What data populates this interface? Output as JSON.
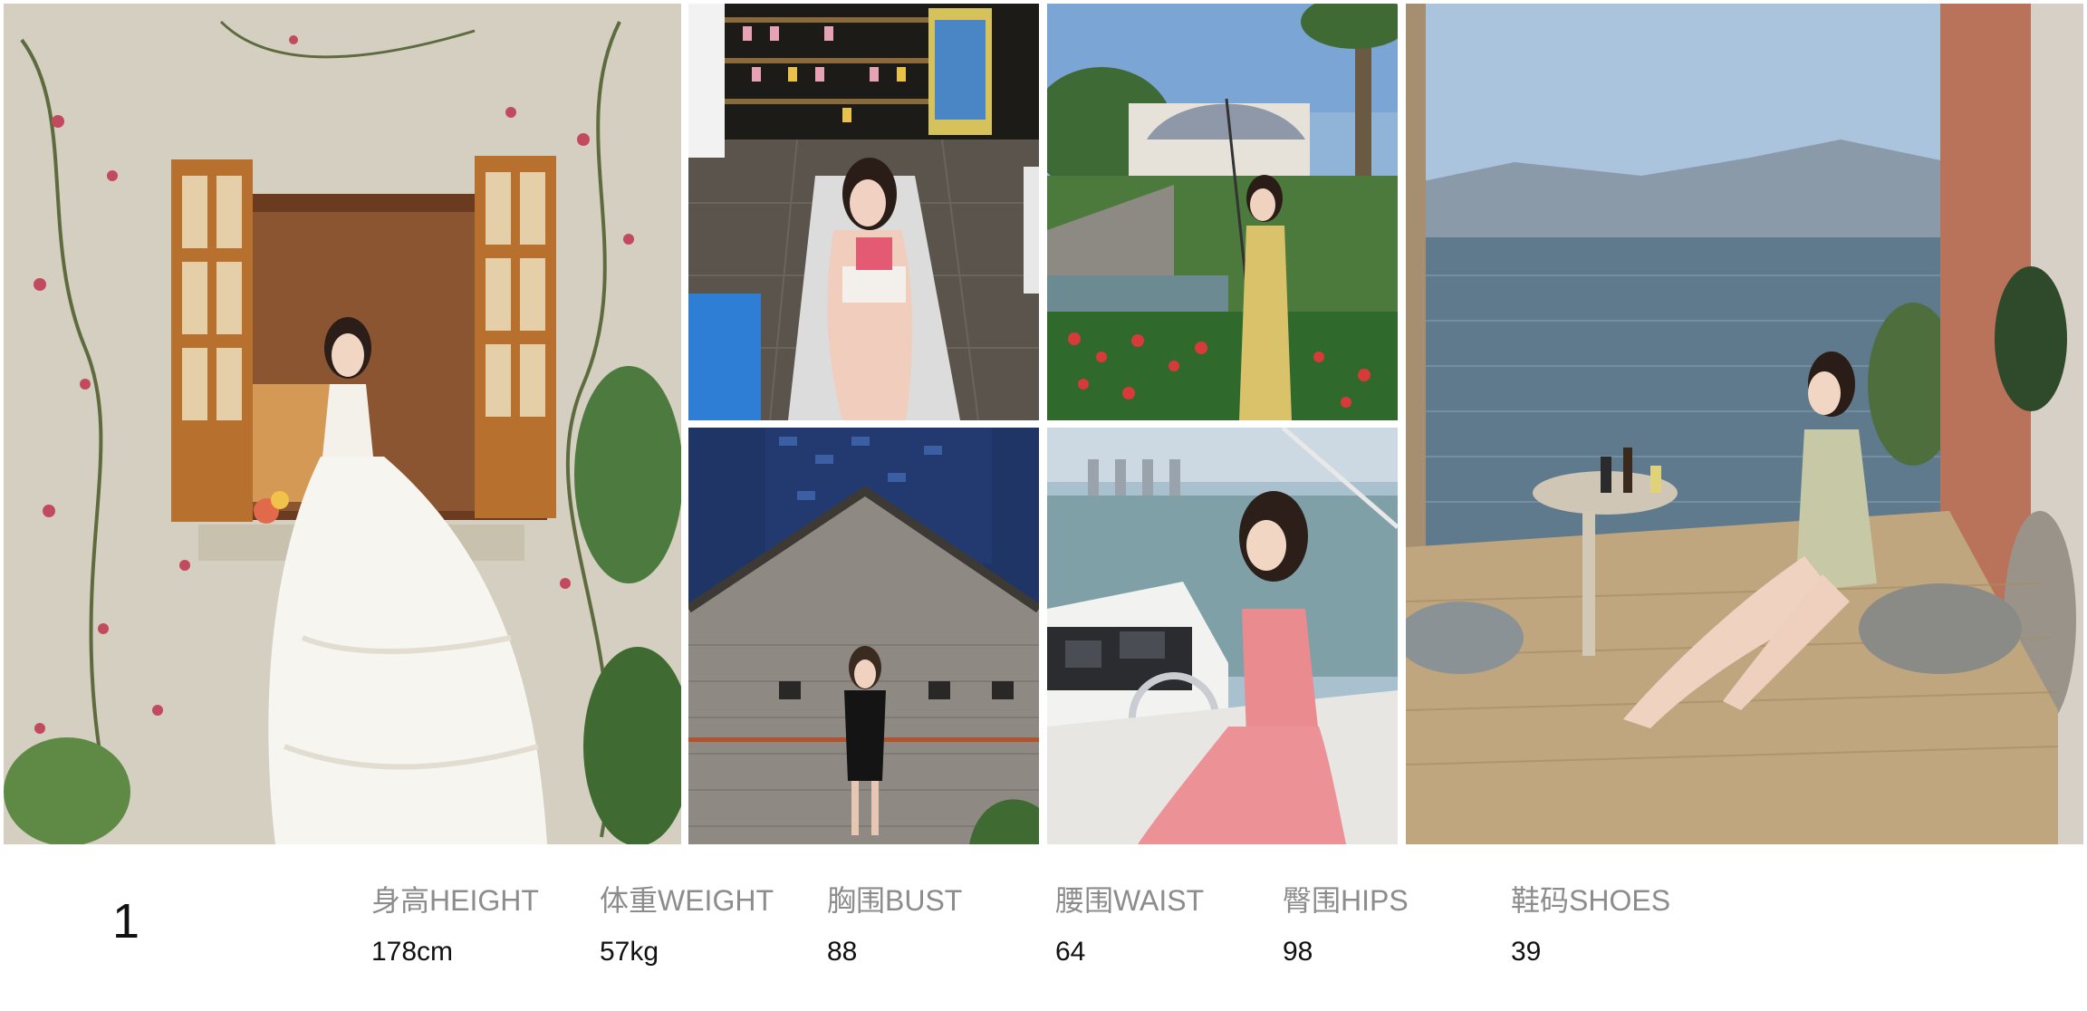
{
  "photos": [
    {
      "id": "p1",
      "scene": "wedding-dress-window"
    },
    {
      "id": "p2",
      "scene": "night-lounge-chair"
    },
    {
      "id": "p3",
      "scene": "night-brick-house"
    },
    {
      "id": "p4",
      "scene": "garden-umbrella"
    },
    {
      "id": "p5",
      "scene": "yacht-helm"
    },
    {
      "id": "p6",
      "scene": "lake-terrace"
    }
  ],
  "model": {
    "number": "1",
    "stats": [
      {
        "key": "height",
        "label": "身高HEIGHT",
        "value": "178cm"
      },
      {
        "key": "weight",
        "label": "体重WEIGHT",
        "value": "57kg"
      },
      {
        "key": "bust",
        "label": "胸围BUST",
        "value": "88"
      },
      {
        "key": "waist",
        "label": "腰围WAIST",
        "value": "64"
      },
      {
        "key": "hips",
        "label": "臀围HIPS",
        "value": "98"
      },
      {
        "key": "shoes",
        "label": "鞋码SHOES",
        "value": "39"
      }
    ]
  },
  "colors": {
    "label": "#8c8c8c",
    "value": "#111111",
    "background": "#ffffff"
  }
}
